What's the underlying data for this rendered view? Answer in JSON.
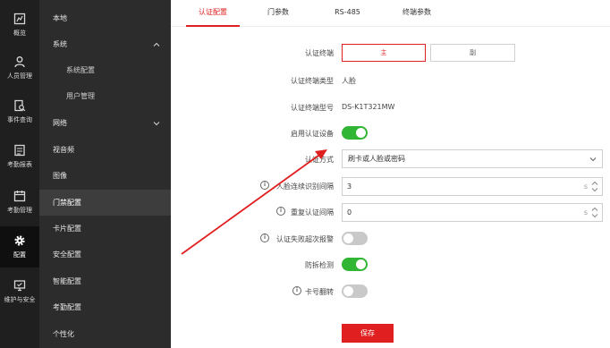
{
  "rail": [
    {
      "icon": "overview-icon",
      "label": "概览"
    },
    {
      "icon": "person-icon",
      "label": "人员管理"
    },
    {
      "icon": "event-search-icon",
      "label": "事件查询"
    },
    {
      "icon": "attendance-report-icon",
      "label": "考勤报表"
    },
    {
      "icon": "attendance-manage-icon",
      "label": "考勤管理"
    },
    {
      "icon": "gear-icon",
      "label": "配置"
    },
    {
      "icon": "maintenance-icon",
      "label": "维护与安全"
    }
  ],
  "submenu": [
    {
      "label": "本地"
    },
    {
      "label": "系统"
    },
    {
      "label": "系统配置"
    },
    {
      "label": "用户管理"
    },
    {
      "label": "网络"
    },
    {
      "label": "视音频"
    },
    {
      "label": "图像"
    },
    {
      "label": "门禁配置"
    },
    {
      "label": "卡片配置"
    },
    {
      "label": "安全配置"
    },
    {
      "label": "智能配置"
    },
    {
      "label": "考勤配置"
    },
    {
      "label": "个性化"
    }
  ],
  "tabs": [
    {
      "label": "认证配置"
    },
    {
      "label": "门参数"
    },
    {
      "label": "RS-485"
    },
    {
      "label": "终端参数"
    }
  ],
  "form": {
    "terminal_label": "认证终端",
    "terminal_main": "主",
    "terminal_sub": "副",
    "terminal_type_label": "认证终端类型",
    "terminal_type_value": "人脸",
    "terminal_model_label": "认证终端型号",
    "terminal_model_value": "DS-K1T321MW",
    "enable_label": "启用认证设备",
    "mode_label": "认证方式",
    "mode_value": "刷卡或人脸或密码",
    "face_interval_label": "人脸连续识别间隔",
    "face_interval_value": "3",
    "face_interval_unit": "s",
    "repeat_interval_label": "重复认证间隔",
    "repeat_interval_value": "0",
    "repeat_interval_unit": "s",
    "fail_alarm_label": "认证失败超次报警",
    "tamper_label": "防拆检测",
    "card_reverse_label": "卡号翻转",
    "info_glyph": "i",
    "save_label": "保存"
  },
  "toggles": {
    "enable": true,
    "fail_alarm": false,
    "tamper": true,
    "card_reverse": false
  },
  "colors": {
    "accent": "#e02020",
    "toggle_on": "#31b534",
    "toggle_off": "#c9c9c9",
    "rail_bg": "#1f1f1f",
    "submenu_bg": "#2c2c2c"
  }
}
